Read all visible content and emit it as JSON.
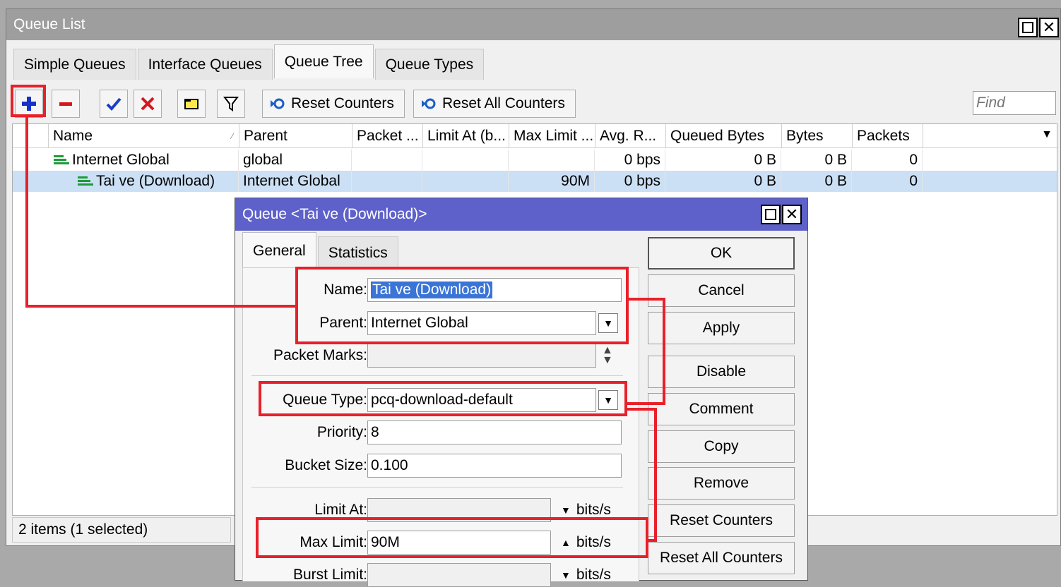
{
  "main_window": {
    "title": "Queue List",
    "tabs": [
      "Simple Queues",
      "Interface Queues",
      "Queue Tree",
      "Queue Types"
    ],
    "active_tab": "Queue Tree",
    "toolbar": {
      "reset_counters": "Reset Counters",
      "reset_all_counters": "Reset All Counters",
      "find_placeholder": "Find"
    },
    "columns": [
      "Name",
      "Parent",
      "Packet ...",
      "Limit At (b...",
      "Max Limit ...",
      "Avg. R...",
      "Queued Bytes",
      "Bytes",
      "Packets"
    ],
    "rows": [
      {
        "name": "Internet Global",
        "parent": "global",
        "packet_marks": "",
        "limit_at": "",
        "max_limit": "",
        "avg_rate": "0 bps",
        "queued_bytes": "0 B",
        "bytes": "0 B",
        "packets": "0"
      },
      {
        "name": "Tai ve (Download)",
        "parent": "Internet Global",
        "packet_marks": "",
        "limit_at": "",
        "max_limit": "90M",
        "avg_rate": "0 bps",
        "queued_bytes": "0 B",
        "bytes": "0 B",
        "packets": "0"
      }
    ],
    "status": "2 items (1 selected)"
  },
  "dialog": {
    "title": "Queue <Tai ve (Download)>",
    "tabs": [
      "General",
      "Statistics"
    ],
    "labels": {
      "name": "Name:",
      "parent": "Parent:",
      "packet_marks": "Packet Marks:",
      "queue_type": "Queue Type:",
      "priority": "Priority:",
      "bucket_size": "Bucket Size:",
      "limit_at": "Limit At:",
      "max_limit": "Max Limit:",
      "burst_limit": "Burst Limit:"
    },
    "values": {
      "name": "Tai ve (Download)",
      "parent": "Internet Global",
      "packet_marks": "",
      "queue_type": "pcq-download-default",
      "priority": "8",
      "bucket_size": "0.100",
      "limit_at": "",
      "max_limit": "90M",
      "burst_limit": ""
    },
    "unit": "bits/s",
    "buttons": [
      "OK",
      "Cancel",
      "Apply",
      "Disable",
      "Comment",
      "Copy",
      "Remove",
      "Reset Counters",
      "Reset All Counters"
    ]
  },
  "colors": {
    "annotation": "#e8202a",
    "dialog_title": "#5e61c9",
    "selection": "#cce0f5",
    "queue_icon": "#1f9a3a"
  }
}
